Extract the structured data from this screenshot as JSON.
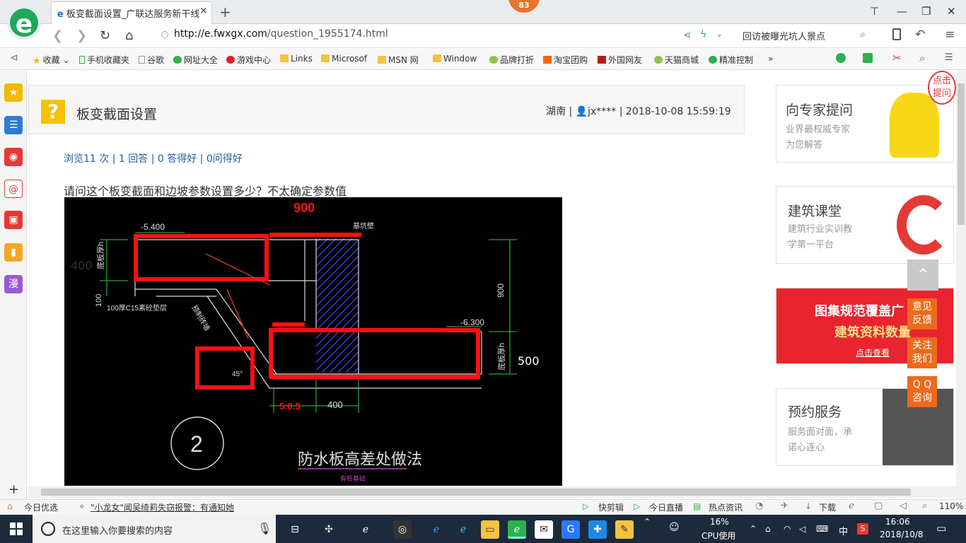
{
  "browser": {
    "tab_title": "板变截面设置_广联达服务新干线",
    "tab_close": "✕",
    "new_tab": "+",
    "badge": "83",
    "url_host": "http://e.fwxgx.com",
    "url_path": "/question_1955174.html",
    "hot_search": "回访被曝光坑人景点"
  },
  "bookmarks": [
    "收藏",
    "手机收藏夹",
    "谷歌",
    "网址大全",
    "游戏中心",
    "Links",
    "Microsof",
    "MSN 网",
    "Window",
    "品牌打折",
    "淘宝团购",
    "外国网友",
    "天猫商城",
    "精准控制"
  ],
  "sidebar": {
    "comic": "漫",
    "add": "+"
  },
  "question": {
    "icon": "?",
    "title": "板变截面设置",
    "region": "湖南",
    "user": "jx****",
    "date": "2018-10-08 15:59:19",
    "views": "浏览11 次",
    "answers": "1 回答",
    "good_answers": "0 答得好",
    "good_questions": "0问得好",
    "body": "请问这个板变截面和边坡参数设置多少？不太确定参数值"
  },
  "drawing": {
    "dim_900_red": "900",
    "elev_top": "-5.400",
    "label_top_right": "基坑壁",
    "dim_400_left": "400",
    "label_slab_thick_left": "底板厚h",
    "dim_100": "100",
    "label_cushion": "100厚C15素砼垫层",
    "label_slope": "预制砖墙",
    "dim_900_right": "900",
    "elev_bottom": "-6.300",
    "label_slab_thick_right": "底板厚h",
    "dim_500_right": "500",
    "dim_400_bottom": "400",
    "dim_red_bottom": "5:0.5",
    "angle": "45°",
    "detail_number": "2",
    "caption": "防水板高差处做法",
    "caption_small": "有桩基础"
  },
  "right_cards": [
    {
      "title": "向专家提问",
      "sub1": "业界最权威专家",
      "sub2": "为您解答"
    },
    {
      "title": "建筑课堂",
      "sub1": "建筑行业实训教",
      "sub2": "学第一平台"
    },
    {
      "title": "预约服务",
      "sub1": "服务面对面，承",
      "sub2": "诺心连心"
    }
  ],
  "banner": {
    "line1": "图集规范覆盖广",
    "line2": "建筑资料数量",
    "button": "点击查看"
  },
  "float_buttons": {
    "click_ask_1": "点击",
    "click_ask_2": "提问",
    "feedback_1": "意见",
    "feedback_2": "反馈",
    "follow_1": "关注",
    "follow_2": "我们",
    "qq_1": "Q Q",
    "qq_2": "咨询"
  },
  "statusbar": {
    "today": "今日优选",
    "news": "\"小龙女\"闻吴绮莉失窃报警：有通知她",
    "clip": "快剪辑",
    "live": "今日直播",
    "hot": "热点资讯",
    "download": "下载",
    "zoom": "110%"
  },
  "taskbar": {
    "search_placeholder": "在这里输入你要搜索的内容",
    "cpu_pct": "16%",
    "cpu_label": "CPU使用",
    "ime": "中",
    "time": "16:06",
    "date": "2018/10/8"
  }
}
